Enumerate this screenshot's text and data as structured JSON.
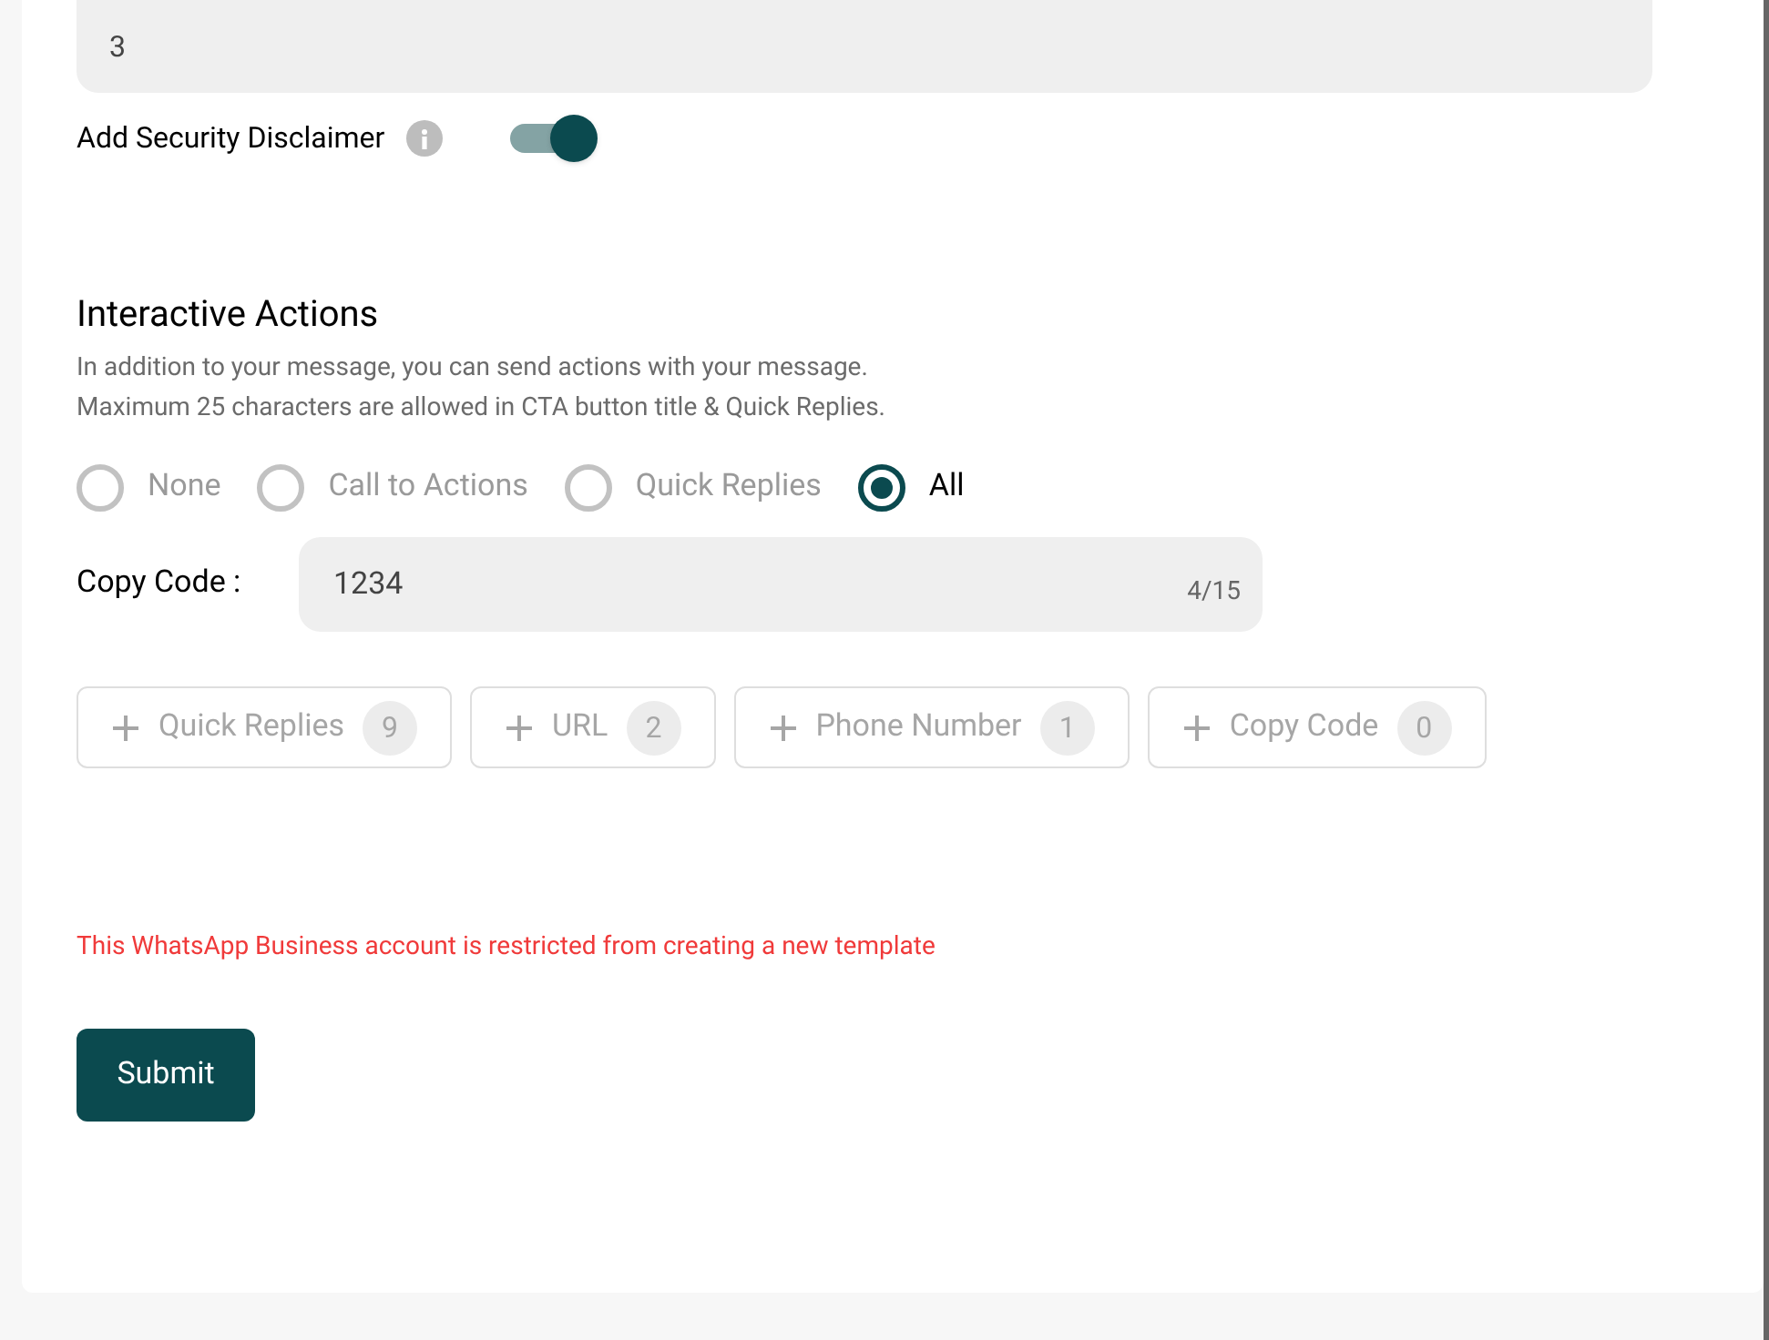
{
  "previous_field": {
    "value": "3"
  },
  "security_disclaimer": {
    "label": "Add Security Disclaimer",
    "on": true
  },
  "interactive_actions": {
    "title": "Interactive Actions",
    "description_lines": [
      "In addition to your message, you can send actions with your message.",
      "Maximum 25 characters are allowed in CTA button title & Quick Replies."
    ],
    "options": [
      {
        "label": "None",
        "selected": false
      },
      {
        "label": "Call to Actions",
        "selected": false
      },
      {
        "label": "Quick Replies",
        "selected": false
      },
      {
        "label": "All",
        "selected": true
      }
    ],
    "copy_code": {
      "label": "Copy Code :",
      "value": "1234",
      "counter": "4/15"
    },
    "add_buttons": [
      {
        "label": "Quick Replies",
        "count": "9",
        "disabled": true
      },
      {
        "label": "URL",
        "count": "2",
        "disabled": true
      },
      {
        "label": "Phone Number",
        "count": "1",
        "disabled": true
      },
      {
        "label": "Copy Code",
        "count": "0",
        "disabled": true
      }
    ]
  },
  "error": "This WhatsApp Business account is restricted from creating a new template",
  "submit": "Submit"
}
